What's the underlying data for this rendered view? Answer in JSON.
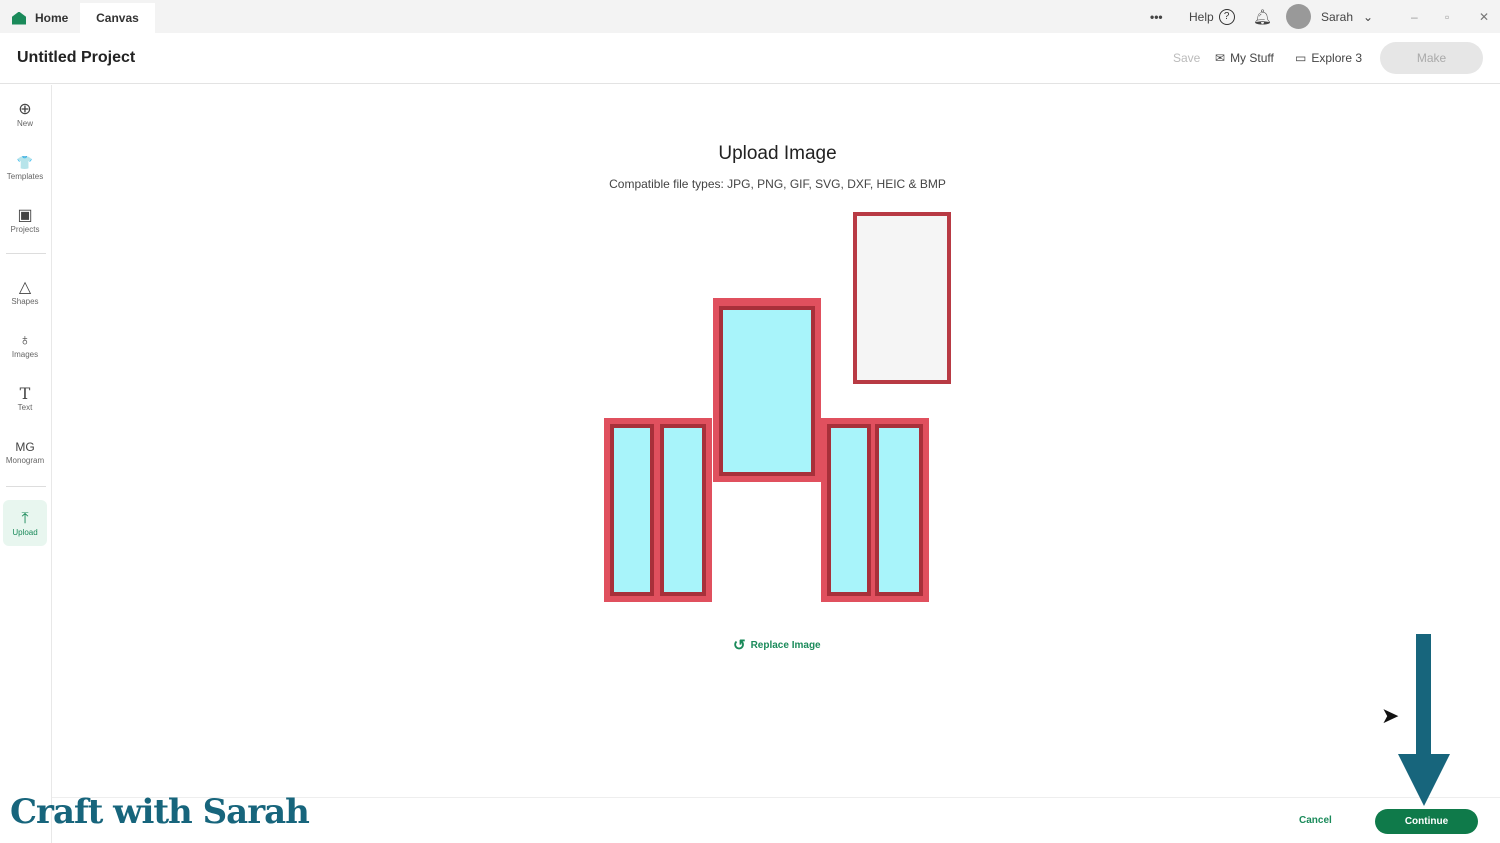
{
  "tabs": {
    "home": "Home",
    "canvas": "Canvas"
  },
  "topbar": {
    "more": "•••",
    "help": "Help",
    "help_icon": "?",
    "user": "Sarah"
  },
  "header": {
    "title": "Untitled Project",
    "save": "Save",
    "my_stuff": "My Stuff",
    "machine": "Explore 3",
    "make": "Make"
  },
  "sidebar": {
    "items": [
      {
        "label": "New",
        "icon": "⊕"
      },
      {
        "label": "Templates",
        "icon": "👕"
      },
      {
        "label": "Projects",
        "icon": "▣"
      },
      {
        "label": "Shapes",
        "icon": "△"
      },
      {
        "label": "Images",
        "icon": "♁"
      },
      {
        "label": "Text",
        "icon": "T"
      },
      {
        "label": "Monogram",
        "icon": "MG"
      },
      {
        "label": "Upload",
        "icon": "⤒"
      }
    ]
  },
  "main": {
    "title": "Upload Image",
    "subtitle": "Compatible file types:  JPG, PNG, GIF, SVG, DXF, HEIC & BMP",
    "replace": "Replace Image"
  },
  "footer": {
    "cancel": "Cancel",
    "continue": "Continue"
  },
  "watermark": "Craft with Sarah",
  "colors": {
    "accent": "#0f7a4a",
    "frame": "#e0505e",
    "glass": "#a8f4fa",
    "arrow": "#17657c"
  }
}
